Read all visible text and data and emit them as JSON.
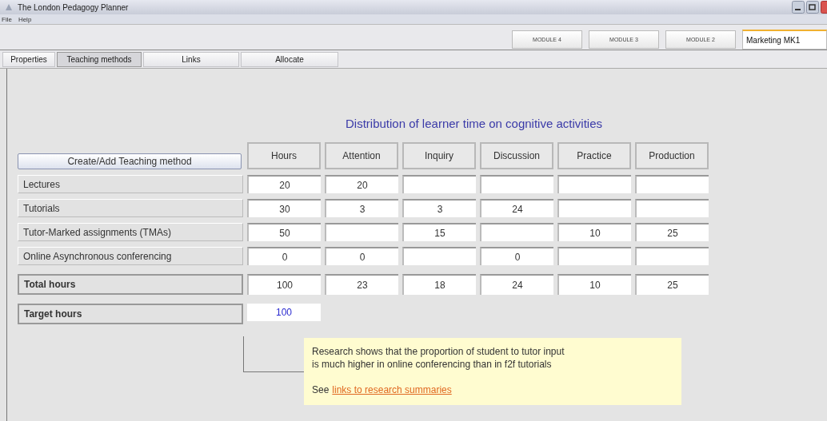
{
  "window": {
    "title": "The London Pedagogy Planner"
  },
  "menu": [
    "File",
    "Help"
  ],
  "module_tabs": [
    {
      "label": "MODULE 4",
      "selected": false
    },
    {
      "label": "MODULE 3",
      "selected": false
    },
    {
      "label": "MODULE 2",
      "selected": false
    },
    {
      "label": "Marketing MK1",
      "selected": true
    }
  ],
  "tabs": [
    {
      "label": "Properties",
      "selected": false
    },
    {
      "label": "Teaching methods",
      "selected": true
    },
    {
      "label": "Links",
      "selected": false
    },
    {
      "label": "Allocate",
      "selected": false
    }
  ],
  "heading": "Distribution of learner time on cognitive activities",
  "create_button": "Create/Add Teaching method",
  "columns": [
    "Hours",
    "Attention",
    "Inquiry",
    "Discussion",
    "Practice",
    "Production"
  ],
  "rows": [
    {
      "label": "Lectures",
      "kind": "method",
      "cells": [
        "20",
        "20",
        null,
        null,
        null,
        null
      ]
    },
    {
      "label": "Tutorials",
      "kind": "method",
      "cells": [
        "30",
        "3",
        "3",
        "24",
        null,
        null
      ]
    },
    {
      "label": "Tutor-Marked assignments (TMAs)",
      "kind": "method",
      "cells": [
        "50",
        null,
        "15",
        null,
        "10",
        "25"
      ]
    },
    {
      "label": "Online Asynchronous conferencing",
      "kind": "method",
      "cells": [
        "0",
        "0",
        null,
        "0",
        null,
        null
      ]
    },
    {
      "label": "Total hours",
      "kind": "total",
      "cells": [
        "100",
        "23",
        "18",
        "24",
        "10",
        "25"
      ]
    },
    {
      "label": "Target hours",
      "kind": "target",
      "cells": [
        "100"
      ]
    }
  ],
  "tooltip": {
    "lines": [
      "Research shows that the proportion of student to tutor input",
      "is much higher in online conferencing than in f2f tutorials"
    ],
    "see": "See",
    "link": "links to research summaries"
  }
}
